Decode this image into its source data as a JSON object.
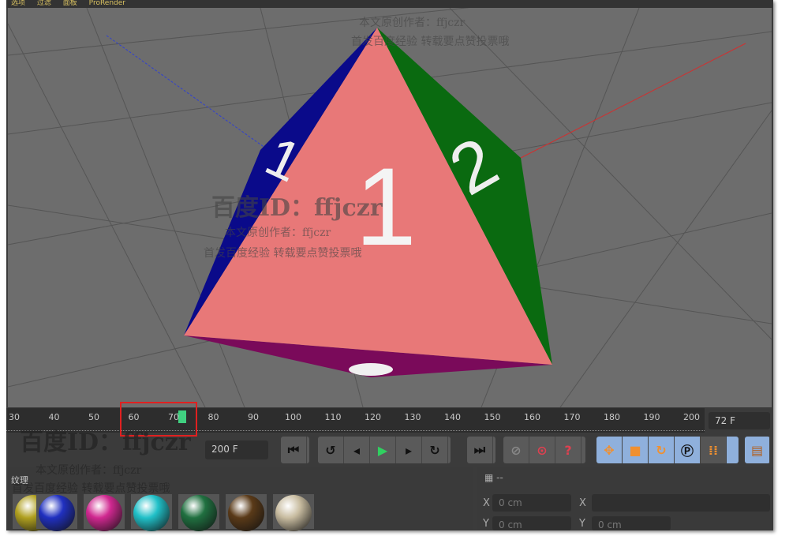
{
  "menu": [
    "选项",
    "过滤",
    "面板",
    "ProRender"
  ],
  "timeline": {
    "ticks": [
      30,
      40,
      50,
      60,
      70,
      72,
      80,
      90,
      100,
      110,
      120,
      130,
      140,
      150,
      160,
      170,
      180,
      190,
      200
    ],
    "current_frame": 72,
    "current_frame_label": "72 F",
    "end_frame_label": "200 F"
  },
  "faces": {
    "front": "1",
    "left": "1",
    "right": "2"
  },
  "materials_panel": {
    "title": "纹理",
    "colors": [
      "#b0a020",
      "#2030c0",
      "#d02890",
      "#20c0c8",
      "#207040",
      "#5a3a18",
      "#c8bca0"
    ]
  },
  "coords": {
    "header": "--",
    "x_label": "X",
    "y_label": "Y",
    "x_value": "0 cm",
    "y_value": "0 cm",
    "y_value2": "0 cm"
  },
  "watermark": {
    "id": "百度ID：ffjczr",
    "author": "本文原创作者：ffjczr",
    "note": "首发百度经验 转载要点赞投票哦"
  },
  "colors": {
    "highlight": "#e02020",
    "keyframe": "#40d080",
    "accent": "#f09030"
  }
}
